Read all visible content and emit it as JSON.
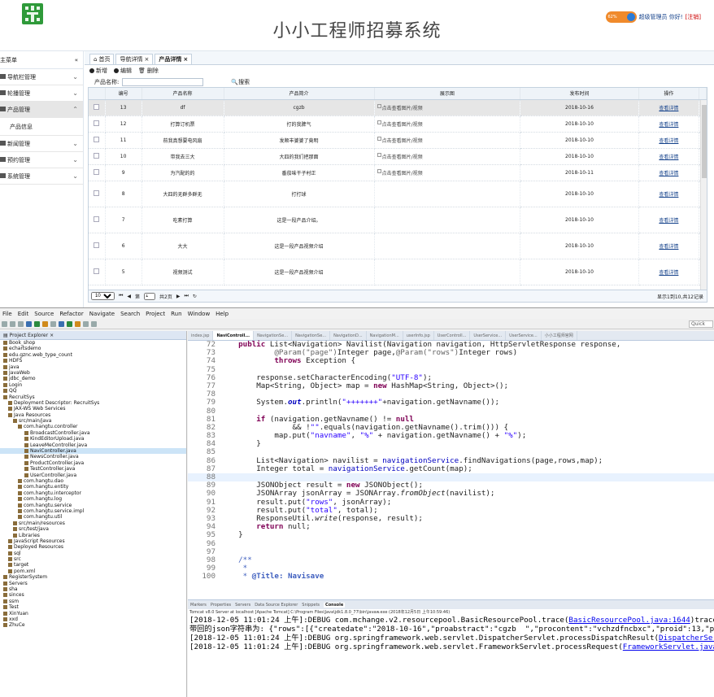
{
  "web": {
    "title": "小小工程师招募系统",
    "user": {
      "greeting": "超级管理员 你好!",
      "logout": "[注销]",
      "net_pct": "62%"
    },
    "sidebar": {
      "header": "主菜单",
      "items": [
        {
          "label": "导航栏管理",
          "active": false
        },
        {
          "label": "轮播管理",
          "active": false
        },
        {
          "label": "产品管理",
          "active": true
        },
        {
          "label": "产品信息",
          "active": false,
          "sub": true
        },
        {
          "label": "新闻管理",
          "active": false
        },
        {
          "label": "预约管理",
          "active": false
        },
        {
          "label": "系统管理",
          "active": false
        }
      ]
    },
    "tabs": [
      {
        "label": "首页",
        "active": false
      },
      {
        "label": "导航详情",
        "active": false
      },
      {
        "label": "产品详情",
        "active": true
      }
    ],
    "toolbar": {
      "add": "新增",
      "edit": "编辑",
      "delete": "删除"
    },
    "search": {
      "label": "产品名称:",
      "value": "",
      "button": "搜索"
    },
    "grid": {
      "headers": [
        "编号",
        "产品名称",
        "产品简介",
        "展示图",
        "发布时间",
        "操作"
      ],
      "rows": [
        {
          "id": "13",
          "name": "df",
          "intro": "cgzb",
          "img": "点击查看图片/视频",
          "date": "2018-10-16",
          "op": "查看详情",
          "selected": true
        },
        {
          "id": "12",
          "name": "打算订机票",
          "intro": "打的我脾气",
          "img": "点击查看图片/视频",
          "date": "2018-10-10",
          "op": "查看详情"
        },
        {
          "id": "11",
          "name": "前我真想要电风扇",
          "intro": "发顺丰婆婆了竟明",
          "img": "点击查看图片/视频",
          "date": "2018-10-10",
          "op": "查看详情"
        },
        {
          "id": "10",
          "name": "带我去三大",
          "intro": "大四的我们把那面",
          "img": "点击查看图片/视频",
          "date": "2018-10-10",
          "op": "查看详情"
        },
        {
          "id": "9",
          "name": "为汽配的的",
          "intro": "番茄味干子村正",
          "img": "点击查看图片/视频",
          "date": "2018-10-11",
          "op": "查看详情"
        },
        {
          "id": "8",
          "name": "大四的无群多群无",
          "intro": "打打球",
          "img": "",
          "date": "2018-10-10",
          "op": "查看详情"
        },
        {
          "id": "7",
          "name": "吃素打算",
          "intro": "这是一段产品介绍。",
          "img": "",
          "date": "2018-10-10",
          "op": "查看详情"
        },
        {
          "id": "6",
          "name": "大大",
          "intro": "这是一段产品视频介绍",
          "img": "",
          "date": "2018-10-10",
          "op": "查看详情"
        },
        {
          "id": "5",
          "name": "视频测试",
          "intro": "这是一段产品视频介绍",
          "img": "",
          "date": "2018-10-10",
          "op": "查看详情"
        }
      ]
    },
    "pager": {
      "page_size": "10",
      "page_label": "第",
      "page": "1",
      "total_pages": "共2页",
      "info": "显示1到10,共12记录"
    }
  },
  "ide": {
    "menus": [
      "File",
      "Edit",
      "Source",
      "Refactor",
      "Navigate",
      "Search",
      "Project",
      "Run",
      "Window",
      "Help"
    ],
    "quick_access": "Quick Access",
    "explorer_title": "Project Explorer",
    "tree": [
      "Book_shop",
      "echartsdemo",
      "edu.gznc.web_type_count",
      "HDFS",
      "java",
      "JavaWeb",
      "jdbc_demo",
      "Login",
      "QQ",
      "RecruitSys",
      "Deployment Descriptor: RecruitSys",
      "JAX-WS Web Services",
      "Java Resources",
      "src/main/java",
      "com.hangtu.controller",
      "BroadcastController.java",
      "KindEditorUpload.java",
      "LeaveMeController.java",
      "NaviController.java",
      "NewsController.java",
      "ProductController.java",
      "TestController.java",
      "UserController.java",
      "com.hangtu.dao",
      "com.hangtu.entity",
      "com.hangtu.interceptor",
      "com.hangtu.log",
      "com.hangtu.service",
      "com.hangtu.service.impl",
      "com.hangtu.util",
      "src/main/resources",
      "src/test/java",
      "Libraries",
      "JavaScript Resources",
      "Deployed Resources",
      "sql",
      "src",
      "target",
      "pom.xml",
      "RegisterSystem",
      "Servers",
      "sha",
      "sinces",
      "ssm",
      "Test",
      "XinYuan",
      "xxd",
      "ZhuCe"
    ],
    "tree_selected": 18,
    "editor_tabs": [
      "index.jsp",
      "NaviControll...",
      "NavigationSe...",
      "NavigationSe...",
      "NavigationD...",
      "NavigationM...",
      "userInfo.jsp",
      "UserControll...",
      "UserService...",
      "UserService...",
      "小小工程师官网"
    ],
    "lines": [
      "72",
      "73",
      "74",
      "75",
      "76",
      "77",
      "78",
      "79",
      "80",
      "81",
      "82",
      "83",
      "84",
      "85",
      "86",
      "87",
      "88",
      "89",
      "90",
      "91",
      "92",
      "93",
      "94",
      "95",
      "96",
      "97",
      "98",
      "99",
      "100"
    ],
    "code": {
      "l72b": "List<Navigation> Navilist(Navigation navigation, HttpServletResponse response,",
      "l73a": "@Param(\"page\")",
      "l73b": "Integer page,",
      "l73c": "@Param(\"rows\")",
      "l73d": "Integer rows)",
      "l74b": "Exception {",
      "l76a": "response.setCharacterEncoding(",
      "l76s": "\"UTF-8\"",
      "l76c": ");",
      "l77a": "Map<String, Object> map = ",
      "l77b": "HashMap<String, Object>();",
      "l79a": "System.",
      "l79f": "out",
      "l79b": ".println(",
      "l79s": "\"+++++++\"",
      "l79c": "+navigation.getNavname());",
      "l81a": "(navigation.getNavname() != ",
      "l82a": "&& !",
      "l82s": "\"\"",
      "l82b": ".equals(navigation.getNavname().trim())) {",
      "l83a": "map.put(",
      "l83s1": "\"navname\"",
      "l83b": ", ",
      "l83s2": "\"%\"",
      "l83c": " + navigation.getNavname() + ",
      "l83s3": "\"%\"",
      "l83d": ");",
      "l84": "}",
      "l86a": "List<Navigation> navilist = ",
      "l86f": "navigationService",
      "l86b": ".findNavigations(page,rows,map);",
      "l87a": "Integer total = ",
      "l87f": "navigationService",
      "l87b": ".getCount(map);",
      "l89a": "JSONObject result = ",
      "l89b": "JSONObject();",
      "l90a": "JSONArray jsonArray = JSONArray.",
      "l90i": "fromObject",
      "l90b": "(navilist);",
      "l91a": "result.put(",
      "l91s": "\"rows\"",
      "l91b": ", jsonArray);",
      "l92a": "result.put(",
      "l92s": "\"total\"",
      "l92b": ", total);",
      "l93a": "ResponseUtil.",
      "l93i": "write",
      "l93b": "(response, result);",
      "l94b": "null;",
      "l95": "}",
      "l98": "/**",
      "l99": "*",
      "l100a": "* ",
      "l100b": "@Title: Navisave"
    },
    "kw": {
      "public": "public",
      "throws": "throws",
      "new": "new",
      "if": "if",
      "null": "null",
      "return": "return"
    },
    "console_tabs": [
      "Markers",
      "Properties",
      "Servers",
      "Data Source Explorer",
      "Snippets",
      "Console"
    ],
    "console_status": "Tomcat v8.0 Server at localhost [Apache Tomcat] C:\\Program Files\\Java\\jdk1.8.0_77\\bin\\javaw.exe (2018年12月5日 上午10:59:46)",
    "console": {
      "c1a": "[2018-12-05 11:01:24 上午]:DEBUG com.mchange.v2.resourcepool.BasicResourcePool.trace(",
      "c1link": "BasicResourcePool.java:1644",
      "c1b": ")trace c",
      "c2": "带回的json字符串为: {\"rows\":[{\"createdate\":\"2018-10-16\",\"proabstract\":\"cgzb  \",\"procontent\":\"vchzdfncbxc\",\"proid\":13,\"pro",
      "c3a": "[2018-12-05 11:01:24 上午]:DEBUG org.springframework.web.servlet.DispatcherServlet.processDispatchResult(",
      "c3link": "DispatcherServl",
      "c4a": "[2018-12-05 11:01:24 上午]:DEBUG org.springframework.web.servlet.FrameworkServlet.processRequest(",
      "c4link": "FrameworkServlet.java:1"
    }
  }
}
